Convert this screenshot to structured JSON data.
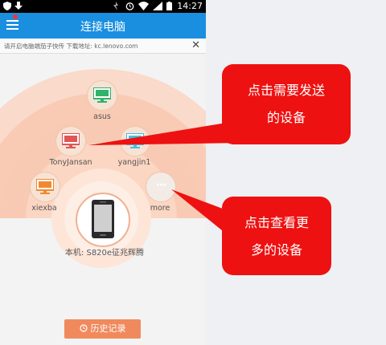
{
  "status": {
    "time": "14:27"
  },
  "header": {
    "title": "连接电脑"
  },
  "notice": {
    "text": "请开启电脑端茄子快传 下载地址: kc.lenovo.com",
    "close": "✕"
  },
  "devices": [
    {
      "name": "asus",
      "screen_color": "#2fb36a"
    },
    {
      "name": "TonyJansan",
      "screen_color": "#e05555"
    },
    {
      "name": "yangjin1",
      "screen_color": "#3fc0e0"
    },
    {
      "name": "xiexba",
      "screen_color": "#f08a30"
    },
    {
      "name": "more",
      "glyph": "···"
    }
  ],
  "local_device": {
    "label": "本机:  S820e征兆辉腾"
  },
  "history_button": {
    "label": "历史记录"
  },
  "callouts": [
    {
      "line1": "点击需要发送",
      "line2": "的设备"
    },
    {
      "line1": "点击查看更",
      "line2": "多的设备"
    }
  ],
  "colors": {
    "header": "#1a8fe0",
    "accent": "#f08a5d",
    "callout": "#ee1111"
  }
}
